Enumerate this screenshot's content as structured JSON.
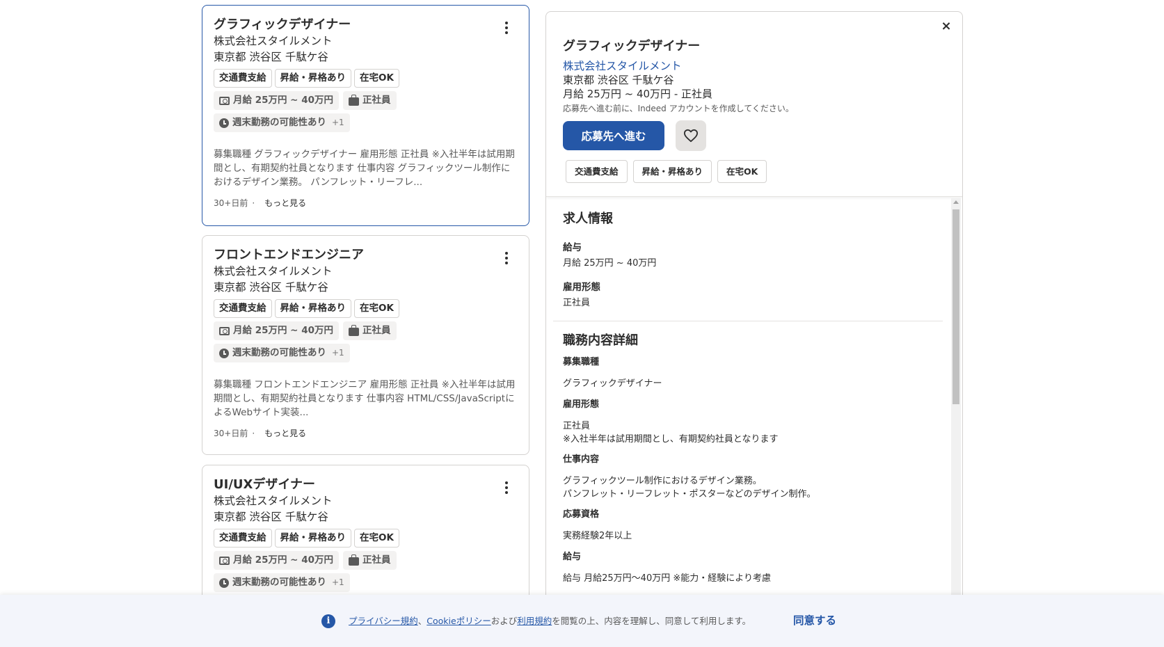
{
  "job_cards": [
    {
      "title": "グラフィックデザイナー",
      "company": "株式会社スタイルメント",
      "location": "東京都 渋谷区 千駄ケ谷",
      "tags": [
        "交通費支給",
        "昇給・昇格あり",
        "在宅OK"
      ],
      "salary": "月給 25万円 ~ 40万円",
      "employment": "正社員",
      "schedule": "週末勤務の可能性あり",
      "schedule_more": "+1",
      "snippet": "募集職種 グラフィックデザイナー 雇用形態 正社員 ※入社半年は試用期間とし、有期契約社員となります 仕事内容 グラフィックツール制作におけるデザイン業務。 パンフレット・リーフレ...",
      "posted": "30+日前",
      "dot": "·",
      "more": "もっと見る",
      "selected": true
    },
    {
      "title": "フロントエンドエンジニア",
      "company": "株式会社スタイルメント",
      "location": "東京都 渋谷区 千駄ケ谷",
      "tags": [
        "交通費支給",
        "昇給・昇格あり",
        "在宅OK"
      ],
      "salary": "月給 25万円 ~ 40万円",
      "employment": "正社員",
      "schedule": "週末勤務の可能性あり",
      "schedule_more": "+1",
      "snippet": "募集職種 フロントエンドエンジニア 雇用形態 正社員 ※入社半年は試用期間とし、有期契約社員となります 仕事内容 HTML/CSS/JavaScriptによるWebサイト実装...",
      "posted": "30+日前",
      "dot": "·",
      "more": "もっと見る",
      "selected": false
    },
    {
      "title": "UI/UXデザイナー",
      "company": "株式会社スタイルメント",
      "location": "東京都 渋谷区 千駄ケ谷",
      "tags": [
        "交通費支給",
        "昇給・昇格あり",
        "在宅OK"
      ],
      "salary": "月給 25万円 ~ 40万円",
      "employment": "正社員",
      "schedule": "週末勤務の可能性あり",
      "schedule_more": "+1",
      "selected": false
    }
  ],
  "detail": {
    "close": "×",
    "title": "グラフィックデザイナー",
    "company": "株式会社スタイルメント",
    "location": "東京都 渋谷区 千駄ケ谷",
    "salary_line": "月給 25万円 ~ 40万円 - 正社員",
    "note": "応募先へ進む前に、Indeed アカウントを作成してください。",
    "apply_label": "応募先へ進む",
    "tags": [
      "交通費支給",
      "昇給・昇格あり",
      "在宅OK"
    ],
    "job_info_heading": "求人情報",
    "salary_label": "給与",
    "salary_value": "月給 25万円 ~ 40万円",
    "employment_label": "雇用形態",
    "employment_value": "正社員",
    "description_heading": "職務内容詳細",
    "desc_position_label": "募集職種",
    "desc_position_value": "グラフィックデザイナー",
    "desc_employment_label": "雇用形態",
    "desc_employment_value": "正社員",
    "desc_employment_note": "※入社半年は試用期間とし、有期契約社員となります",
    "desc_work_label": "仕事内容",
    "desc_work_line1": "グラフィックツール制作におけるデザイン業務。",
    "desc_work_line2": "パンフレット・リーフレット・ポスターなどのデザイン制作。",
    "desc_req_label": "応募資格",
    "desc_req_value": "実務経験2年以上",
    "desc_salary_label": "給与",
    "desc_salary_value": "給与 月給25万円～40万円 ※能力・経験により考慮"
  },
  "cookie": {
    "privacy_link": "プライバシー規約",
    "sep1": "、",
    "cookie_link": "Cookieポリシー",
    "and": "および",
    "terms_link": "利用規約",
    "rest": "を閲覧の上、内容を理解し、同意して利用します。",
    "agree_label": "同意する",
    "info_icon": "i"
  },
  "colors": {
    "accent": "#2557a7",
    "border": "#d4d2d0",
    "text": "#2d2d2d"
  }
}
